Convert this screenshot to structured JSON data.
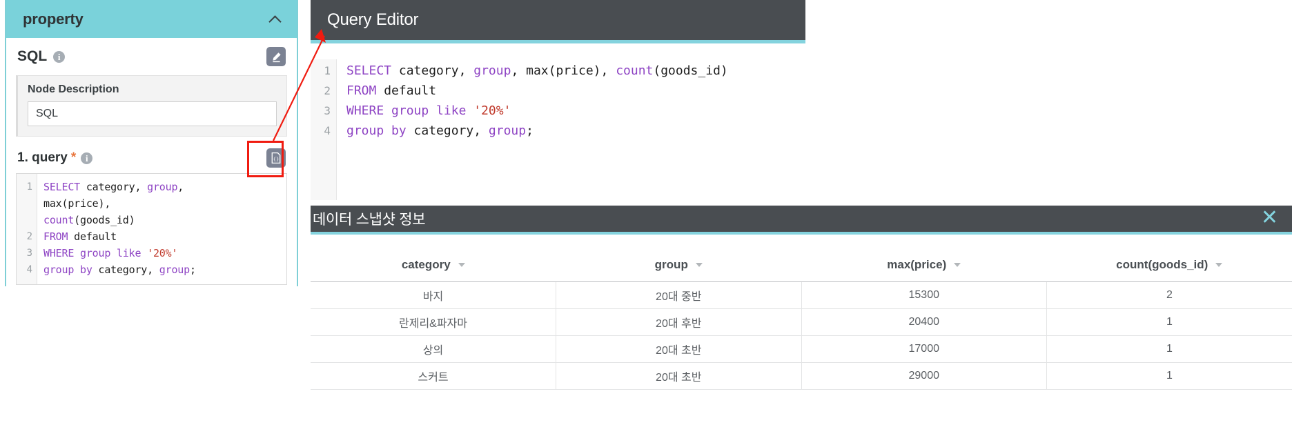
{
  "property_panel": {
    "title": "property",
    "collapse_icon": "chevron-up-icon",
    "sql_section": {
      "label": "SQL",
      "info_icon": "info-icon",
      "edit_icon": "pencil-edit-icon"
    },
    "node_description": {
      "label": "Node Description",
      "value": "SQL"
    },
    "query_field": {
      "label": "1. query",
      "required_mark": "*",
      "info_icon": "info-icon",
      "open_editor_icon": "code-braces-document-icon"
    },
    "code_lines": [
      {
        "number": "1",
        "tokens": [
          {
            "t": "SELECT",
            "c": "kw"
          },
          {
            "t": " category, ",
            "c": "idt"
          },
          {
            "t": "group",
            "c": "kw"
          },
          {
            "t": ",",
            "c": "idt"
          }
        ]
      },
      {
        "number": "",
        "tokens": [
          {
            "t": "max",
            "c": "idt"
          },
          {
            "t": "(price),",
            "c": "idt"
          }
        ]
      },
      {
        "number": "",
        "tokens": [
          {
            "t": "count",
            "c": "kw"
          },
          {
            "t": "(goods_id)",
            "c": "idt"
          }
        ]
      },
      {
        "number": "2",
        "tokens": [
          {
            "t": "FROM",
            "c": "kw"
          },
          {
            "t": " default",
            "c": "idt"
          }
        ]
      },
      {
        "number": "3",
        "tokens": [
          {
            "t": "WHERE ",
            "c": "kw"
          },
          {
            "t": "group like ",
            "c": "kw"
          },
          {
            "t": "'20%'",
            "c": "str"
          }
        ]
      },
      {
        "number": "4",
        "tokens": [
          {
            "t": "group by",
            "c": "kw"
          },
          {
            "t": " category, ",
            "c": "idt"
          },
          {
            "t": "group",
            "c": "kw"
          },
          {
            "t": ";",
            "c": "idt"
          }
        ]
      }
    ]
  },
  "query_editor": {
    "title": "Query Editor",
    "code_lines": [
      {
        "number": "1",
        "tokens": [
          {
            "t": "SELECT",
            "c": "kw"
          },
          {
            "t": " category, ",
            "c": "idt"
          },
          {
            "t": "group",
            "c": "kw"
          },
          {
            "t": ", ",
            "c": "idt"
          },
          {
            "t": "max",
            "c": "idt"
          },
          {
            "t": "(price), ",
            "c": "idt"
          },
          {
            "t": "count",
            "c": "kw"
          },
          {
            "t": "(goods_id)",
            "c": "idt"
          }
        ]
      },
      {
        "number": "2",
        "tokens": [
          {
            "t": "FROM",
            "c": "kw"
          },
          {
            "t": " default",
            "c": "idt"
          }
        ]
      },
      {
        "number": "3",
        "tokens": [
          {
            "t": "WHERE ",
            "c": "kw"
          },
          {
            "t": "group like ",
            "c": "kw"
          },
          {
            "t": "'20%'",
            "c": "str"
          }
        ]
      },
      {
        "number": "4",
        "tokens": [
          {
            "t": "group by",
            "c": "kw"
          },
          {
            "t": " category, ",
            "c": "idt"
          },
          {
            "t": "group",
            "c": "kw"
          },
          {
            "t": ";",
            "c": "idt"
          }
        ]
      }
    ]
  },
  "snapshot": {
    "title": "데이터 스냅샷 정보",
    "close_icon": "close-x-icon",
    "columns": [
      "category",
      "group",
      "max(price)",
      "count(goods_id)"
    ],
    "rows": [
      [
        "바지",
        "20대 중반",
        "15300",
        "2"
      ],
      [
        "란제리&파자마",
        "20대 후반",
        "20400",
        "1"
      ],
      [
        "상의",
        "20대 초반",
        "17000",
        "1"
      ],
      [
        "스커트",
        "20대 초반",
        "29000",
        "1"
      ]
    ]
  },
  "annotation": {
    "highlight_color": "#f01b10",
    "arrow_color": "#f01b10"
  },
  "colors": {
    "teal": "#7ad2da",
    "dark_header": "#494d51",
    "accent_underline": "#84d3de",
    "keyword": "#8e44c4",
    "string": "#c0392b"
  }
}
